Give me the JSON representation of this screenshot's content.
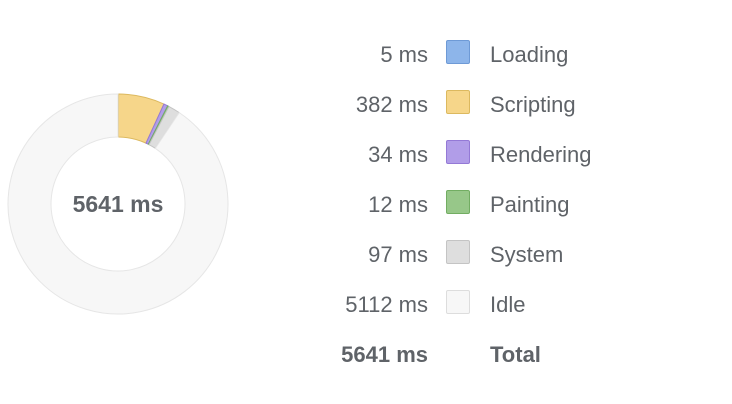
{
  "summary": {
    "total_center": "5641 ms",
    "rows": [
      {
        "value": "5 ms",
        "label": "Loading",
        "color": "#8db5ea",
        "border": "#6e9ad6",
        "ms": 5
      },
      {
        "value": "382 ms",
        "label": "Scripting",
        "color": "#f6d68a",
        "border": "#dcb95f",
        "ms": 382
      },
      {
        "value": "34 ms",
        "label": "Rendering",
        "color": "#b19de8",
        "border": "#9479d6",
        "ms": 34
      },
      {
        "value": "12 ms",
        "label": "Painting",
        "color": "#97c789",
        "border": "#72ad62",
        "ms": 12
      },
      {
        "value": "97 ms",
        "label": "System",
        "color": "#dedede",
        "border": "#c4c4c4",
        "ms": 97
      },
      {
        "value": "5112 ms",
        "label": "Idle",
        "color": "#f7f7f7",
        "border": "#dddddd",
        "ms": 5112
      }
    ],
    "total": {
      "value": "5641 ms",
      "label": "Total"
    }
  }
}
